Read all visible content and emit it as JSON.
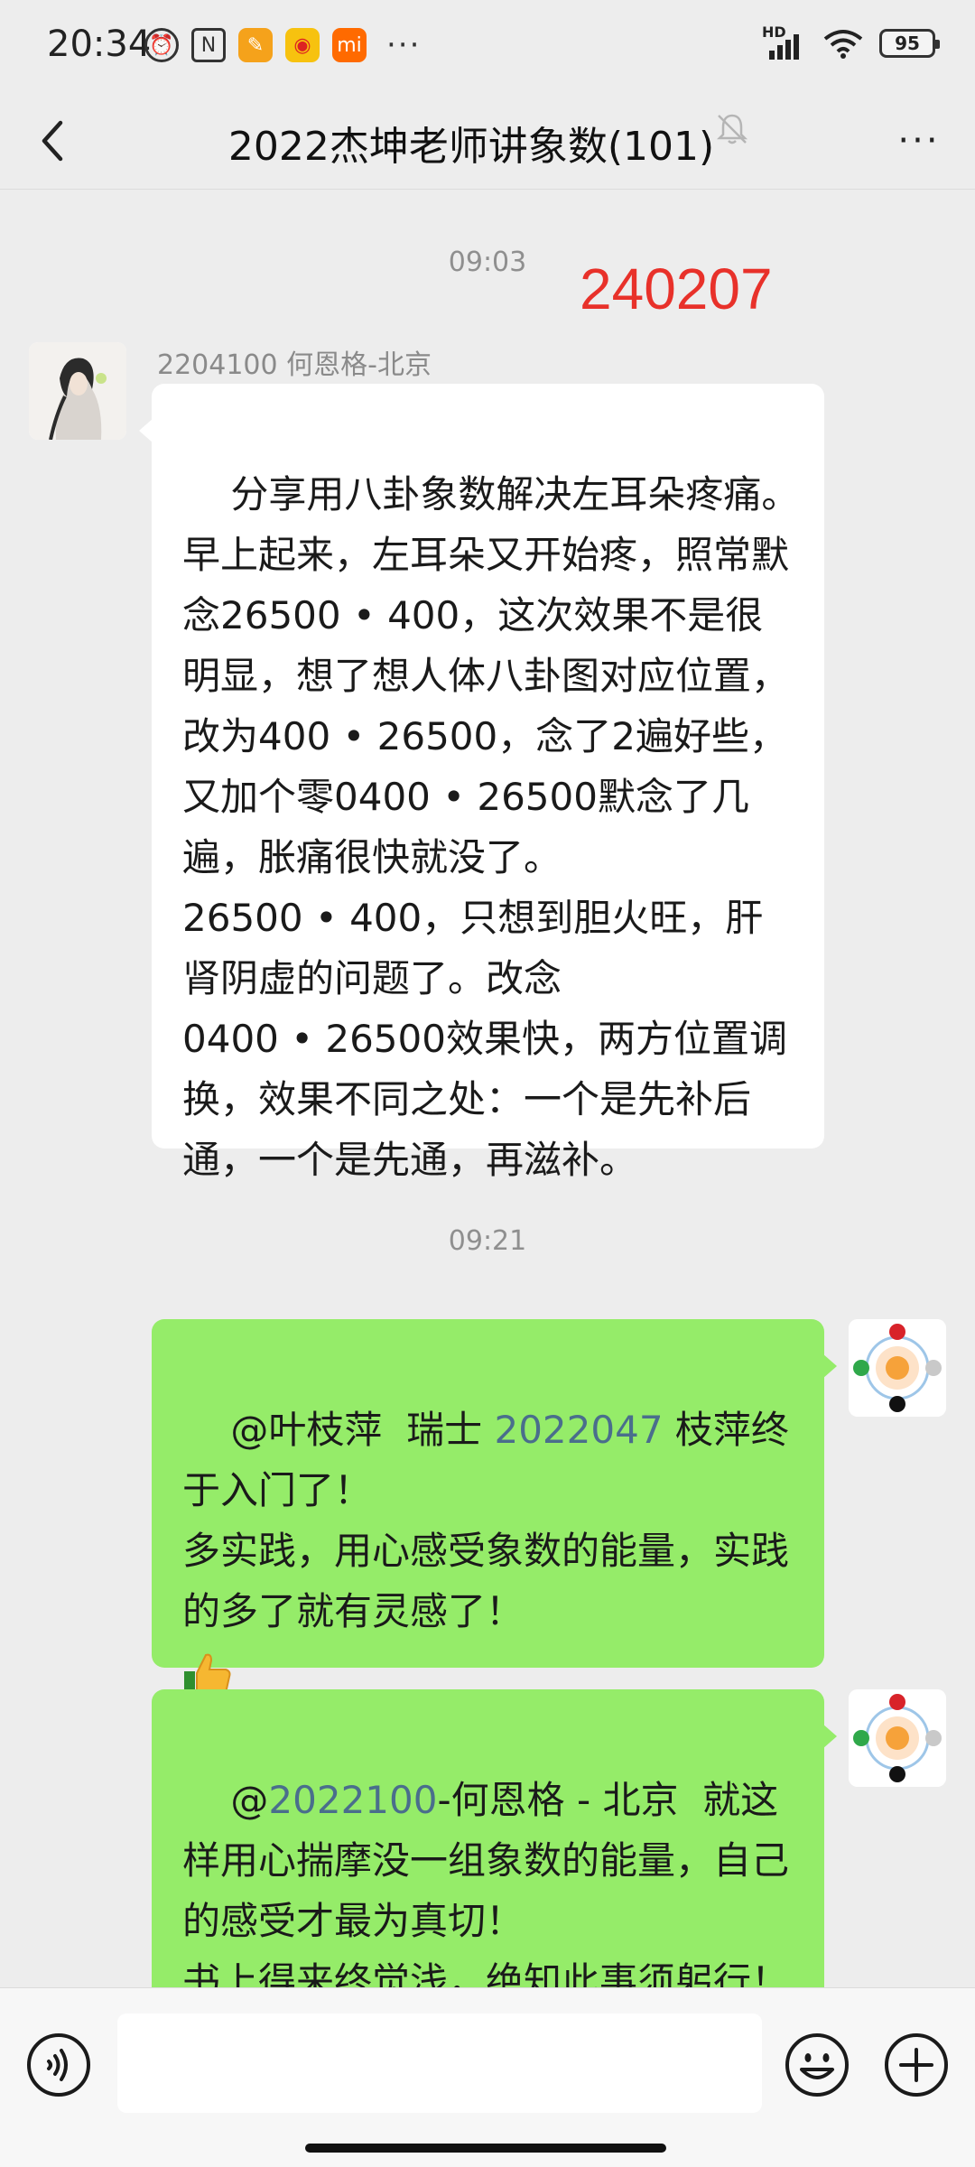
{
  "status_bar": {
    "time": "20:34",
    "battery": "95",
    "network_badge": "HD"
  },
  "header": {
    "title": "2022杰坤老师讲象数(101)"
  },
  "annotation": "240207",
  "messages": [
    {
      "timestamp": "09:03",
      "sender_name": "2204100 何恩格-北京",
      "text": "分享用八卦象数解决左耳朵疼痛。早上起来，左耳朵又开始疼，照常默念26500 • 400，这次效果不是很明显，想了想人体八卦图对应位置，改为400 • 26500，念了2遍好些，又加个零0400 • 26500默念了几遍，胀痛很快就没了。\n26500 • 400，只想到胆火旺，肝肾阴虚的问题了。改念\n0400 • 26500效果快，两方位置调换，效果不同之处：一个是先补后通，一个是先通，再滋补。"
    },
    {
      "timestamp": "09:21",
      "mention": "@叶枝萍",
      "mention_rest": "  瑞士",
      "mention_num": "2022047",
      "text_after_mention": " 枝萍终于入门了！\n多实践，用心感受象数的能量，实践的多了就有灵感了！",
      "emoji": "thumbs-up"
    },
    {
      "mention": "@",
      "mention_num": "2022100",
      "mention_rest": "-何恩格 - 北京",
      "text_after_mention": "  就这样用心揣摩没一组象数的能量，自己的感受才最为真切！\n书上得来终觉浅，绝知此事须躬行！"
    }
  ],
  "input": {
    "placeholder": ""
  }
}
